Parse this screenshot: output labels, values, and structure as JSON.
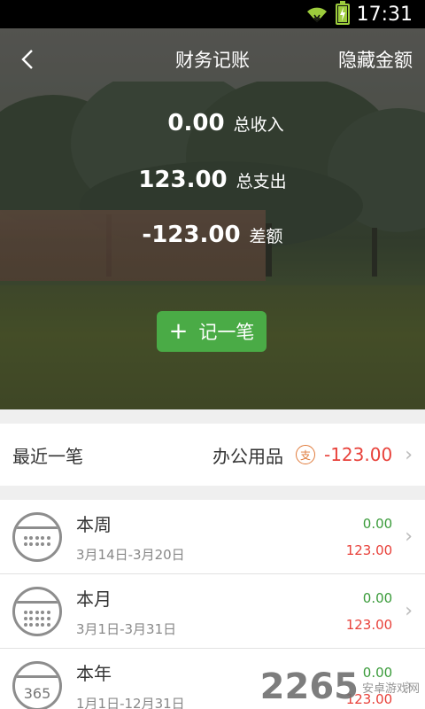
{
  "status_bar": {
    "time": "17:31"
  },
  "header": {
    "title": "财务记账",
    "hide_amount": "隐藏金额"
  },
  "summary": {
    "income_value": "0.00",
    "income_label": "总收入",
    "expense_value": "123.00",
    "expense_label": "总支出",
    "diff_value": "-123.00",
    "diff_label": "差额"
  },
  "add_button": {
    "label": "记一笔"
  },
  "recent": {
    "title": "最近一笔",
    "category": "办公用品",
    "type_badge": "支",
    "amount": "-123.00"
  },
  "periods": [
    {
      "name": "本周",
      "range": "3月14日-3月20日",
      "income": "0.00",
      "expense": "123.00",
      "icon": "calendar-dots-icon"
    },
    {
      "name": "本月",
      "range": "3月1日-3月31日",
      "income": "0.00",
      "expense": "123.00",
      "icon": "calendar-dots-icon"
    },
    {
      "name": "本年",
      "range": "1月1日-12月31日",
      "income": "0.00",
      "expense": "123.00",
      "icon_text": "365"
    }
  ],
  "watermark": {
    "main": "2265",
    "sub": "安卓游戏网"
  },
  "colors": {
    "accent_green": "#4aab46",
    "income_green": "#3a9b3a",
    "expense_red": "#e8413a"
  }
}
